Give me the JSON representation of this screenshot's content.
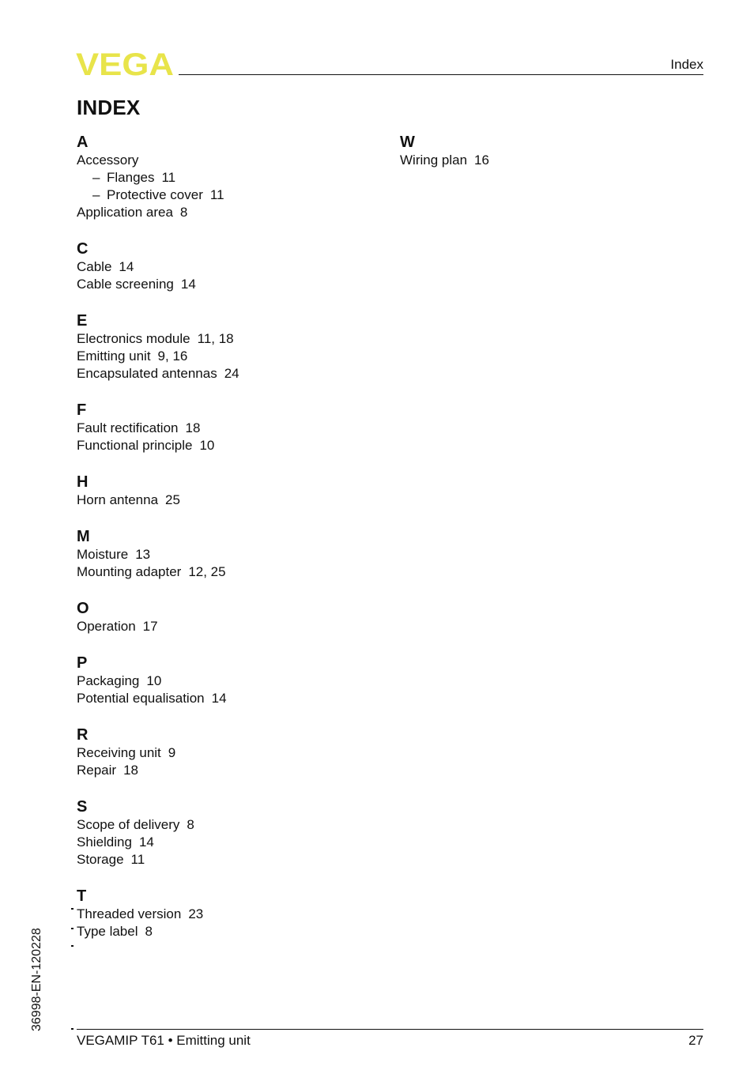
{
  "header": {
    "logo_text": "VEGA",
    "logo_color": "#e8e44a",
    "section": "Index"
  },
  "title": "INDEX",
  "columns": [
    [
      {
        "letter": "A",
        "entries": [
          {
            "term": "Accessory",
            "pages": "",
            "sub": false
          },
          {
            "term": "Flanges",
            "pages": "11",
            "sub": true
          },
          {
            "term": "Protective cover",
            "pages": "11",
            "sub": true
          },
          {
            "term": "Application area",
            "pages": "8",
            "sub": false
          }
        ]
      },
      {
        "letter": "C",
        "entries": [
          {
            "term": "Cable",
            "pages": "14",
            "sub": false
          },
          {
            "term": "Cable screening",
            "pages": "14",
            "sub": false
          }
        ]
      },
      {
        "letter": "E",
        "entries": [
          {
            "term": "Electronics module",
            "pages": "11, 18",
            "sub": false
          },
          {
            "term": "Emitting unit",
            "pages": "9, 16",
            "sub": false
          },
          {
            "term": "Encapsulated antennas",
            "pages": "24",
            "sub": false
          }
        ]
      },
      {
        "letter": "F",
        "entries": [
          {
            "term": "Fault rectification",
            "pages": "18",
            "sub": false
          },
          {
            "term": "Functional principle",
            "pages": "10",
            "sub": false
          }
        ]
      },
      {
        "letter": "H",
        "entries": [
          {
            "term": "Horn antenna",
            "pages": "25",
            "sub": false
          }
        ]
      },
      {
        "letter": "M",
        "entries": [
          {
            "term": "Moisture",
            "pages": "13",
            "sub": false
          },
          {
            "term": "Mounting adapter",
            "pages": "12, 25",
            "sub": false
          }
        ]
      },
      {
        "letter": "O",
        "entries": [
          {
            "term": "Operation",
            "pages": "17",
            "sub": false
          }
        ]
      },
      {
        "letter": "P",
        "entries": [
          {
            "term": "Packaging",
            "pages": "10",
            "sub": false
          },
          {
            "term": "Potential equalisation",
            "pages": "14",
            "sub": false
          }
        ]
      },
      {
        "letter": "R",
        "entries": [
          {
            "term": "Receiving unit",
            "pages": "9",
            "sub": false
          },
          {
            "term": "Repair",
            "pages": "18",
            "sub": false
          }
        ]
      },
      {
        "letter": "S",
        "entries": [
          {
            "term": "Scope of delivery",
            "pages": "8",
            "sub": false
          },
          {
            "term": "Shielding",
            "pages": "14",
            "sub": false
          },
          {
            "term": "Storage",
            "pages": "11",
            "sub": false
          }
        ]
      },
      {
        "letter": "T",
        "entries": [
          {
            "term": "Threaded version",
            "pages": "23",
            "sub": false
          },
          {
            "term": "Type label",
            "pages": "8",
            "sub": false
          }
        ]
      }
    ],
    [
      {
        "letter": "W",
        "entries": [
          {
            "term": "Wiring plan",
            "pages": "16",
            "sub": false
          }
        ]
      }
    ]
  ],
  "sub_marker": "–",
  "side_code": "36998-EN-120228",
  "footer": {
    "product": "VEGAMIP T61 • Emitting unit",
    "page_number": "27"
  }
}
